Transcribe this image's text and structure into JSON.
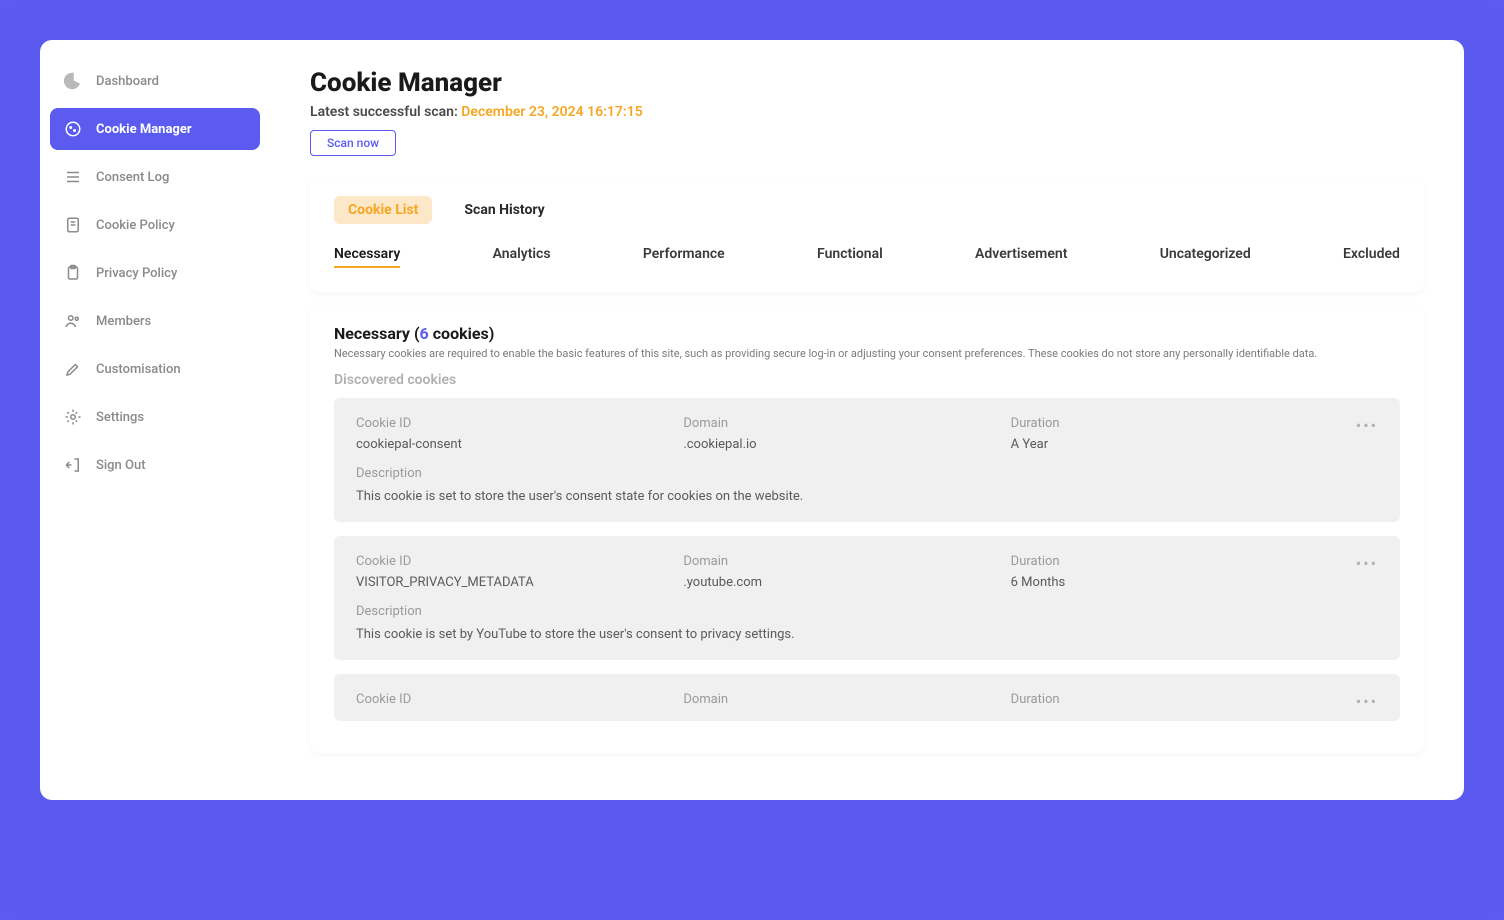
{
  "sidebar": {
    "items": [
      {
        "id": "dashboard",
        "label": "Dashboard"
      },
      {
        "id": "cookie-manager",
        "label": "Cookie Manager"
      },
      {
        "id": "consent-log",
        "label": "Consent Log"
      },
      {
        "id": "cookie-policy",
        "label": "Cookie Policy"
      },
      {
        "id": "privacy-policy",
        "label": "Privacy Policy"
      },
      {
        "id": "members",
        "label": "Members"
      },
      {
        "id": "customisation",
        "label": "Customisation"
      },
      {
        "id": "settings",
        "label": "Settings"
      },
      {
        "id": "sign-out",
        "label": "Sign Out"
      }
    ]
  },
  "header": {
    "title": "Cookie Manager",
    "scan_label": "Latest successful scan: ",
    "scan_time": "December 23, 2024 16:17:15",
    "scan_button": "Scan now"
  },
  "tabs_top": [
    {
      "id": "cookie-list",
      "label": "Cookie List"
    },
    {
      "id": "scan-history",
      "label": "Scan History"
    }
  ],
  "tabs_cat": [
    {
      "id": "necessary",
      "label": "Necessary"
    },
    {
      "id": "analytics",
      "label": "Analytics"
    },
    {
      "id": "performance",
      "label": "Performance"
    },
    {
      "id": "functional",
      "label": "Functional"
    },
    {
      "id": "advertisement",
      "label": "Advertisement"
    },
    {
      "id": "uncategorized",
      "label": "Uncategorized"
    },
    {
      "id": "excluded",
      "label": "Excluded"
    }
  ],
  "section": {
    "title_prefix": "Necessary (",
    "count": "6",
    "title_suffix": " cookies)",
    "description": "Necessary cookies are required to enable the basic features of this site, such as providing secure log-in or adjusting your consent preferences. These cookies do not store any personally identifiable data.",
    "discovered_label": "Discovered cookies"
  },
  "labels": {
    "cookie_id": "Cookie ID",
    "domain": "Domain",
    "duration": "Duration",
    "description": "Description"
  },
  "cookies": [
    {
      "id": "cookiepal-consent",
      "domain": ".cookiepal.io",
      "duration": "A Year",
      "description": "This cookie is set to store the user's consent state for cookies on the website."
    },
    {
      "id": "VISITOR_PRIVACY_METADATA",
      "domain": ".youtube.com",
      "duration": "6 Months",
      "description": "This cookie is set by YouTube to store the user's consent to privacy settings."
    },
    {
      "id": "",
      "domain": "",
      "duration": "",
      "description": ""
    }
  ]
}
